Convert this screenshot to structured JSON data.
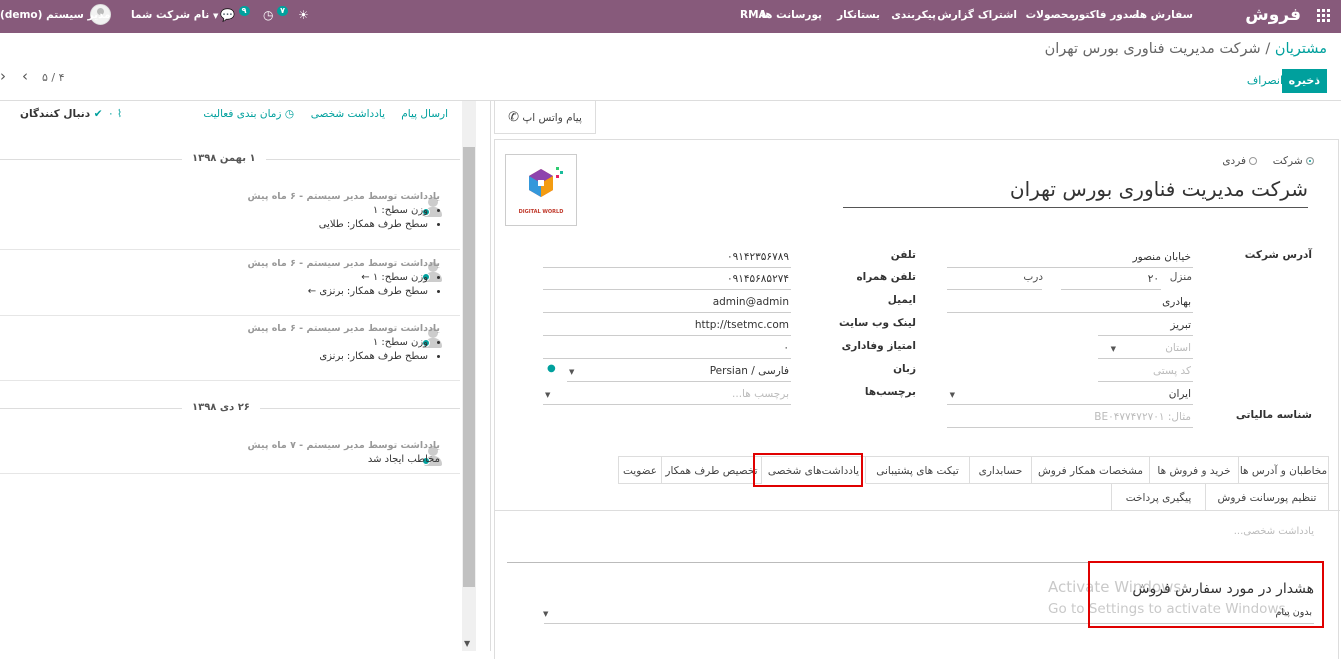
{
  "topbar": {
    "brand": "فروش",
    "menu": [
      "سفارش ها",
      "صدور فاکتور",
      "محصولات",
      "اشتراک",
      "گزارش",
      "پیکربندی",
      "بستانکار",
      "پورسانت ها",
      "RMA"
    ],
    "messages_count": "۹",
    "activities_count": "۷",
    "company": "نام شرکت شما",
    "user": "مدیر سیستم (demo)"
  },
  "breadcrumb": {
    "parent": "مشتریان",
    "separator": "/",
    "current": "شرکت مدیریت فناوری بورس تهران"
  },
  "buttons": {
    "save": "ذخیره",
    "discard": "انصراف"
  },
  "pager": {
    "value": "۵ / ۴"
  },
  "stat": {
    "whatsapp": "پیام واتس اپ"
  },
  "company_type": {
    "individual": "فردی",
    "company": "شرکت",
    "selected": "company"
  },
  "partner_name": "شرکت مدیریت فناوری بورس تهران",
  "logo": {
    "text": "DIGITAL WORLD"
  },
  "address": {
    "label": "آدرس شرکت",
    "street": "خیابان منصور",
    "unit_label": "منزل",
    "unit": "۲۰",
    "door_label": "درب",
    "street2": "بهادری",
    "city": "تبریز",
    "state_placeholder": "استان",
    "zip_placeholder": "کد پستی",
    "country": "ایران"
  },
  "vat": {
    "label": "شناسه مالیاتی",
    "placeholder": "مثال: BE۰۴۷۷۴۷۲۷۰۱"
  },
  "contact": {
    "phone_label": "تلفن",
    "phone": "۰۹۱۴۲۳۵۶۷۸۹",
    "mobile_label": "تلفن همراه",
    "mobile": "۰۹۱۴۵۶۸۵۲۷۴",
    "email_label": "ایمیل",
    "email": "admin@admin",
    "website_label": "لینک وب سایت",
    "website": "http://tsetmc.com",
    "loyalty_label": "امتیاز وفاداری",
    "loyalty": "۰",
    "lang_label": "زبان",
    "lang": "Persian / فارسی",
    "tags_label": "برچسب‌ها",
    "tags_placeholder": "برچسب ها..."
  },
  "tabs": [
    "مخاطبان و آدرس ها",
    "خرید و فروش ها",
    "مشخصات همکار فروش",
    "حسابداری",
    "تیکت های پشتیبانی",
    "یادداشت‌های شخصی",
    "تخصیص طرف همکار",
    "عضویت",
    "تنظیم پورسانت فروش",
    "پیگیری پرداخت"
  ],
  "notes": {
    "placeholder": "یادداشت شخصی...",
    "warning_title": "هشدار در مورد سفارش فروش",
    "warning_value": "بدون پیام"
  },
  "watermark": {
    "line1": "Activate Windows",
    "line2": "Go to Settings to activate Windows."
  },
  "chatter": {
    "send_message": "ارسال پیام",
    "log_note": "یادداشت شخصی",
    "schedule": "زمان بندی فعالیت",
    "attachments": "۰",
    "followers": "دنبال کنندگان",
    "date1": "۱ بهمن ۱۳۹۸",
    "date2": "۲۶ دی ۱۳۹۸",
    "messages": [
      {
        "author": "یادداشت توسط مدیر سیستم",
        "ago": "۶ ماه پیش",
        "lines": [
          "وزن سطح: ۱",
          "سطح طرف همکار: طلایی"
        ]
      },
      {
        "author": "یادداشت توسط مدیر سیستم",
        "ago": "۶ ماه پیش",
        "lines": [
          "وزن سطح: ۱ ←",
          "سطح طرف همکار: برنزی ←"
        ]
      },
      {
        "author": "یادداشت توسط مدیر سیستم",
        "ago": "۶ ماه پیش",
        "lines": [
          "وزن سطح: ۱",
          "سطح طرف همکار: برنزی"
        ]
      },
      {
        "author": "یادداشت توسط مدیر سیستم",
        "ago": "۷ ماه پیش",
        "lines": [
          "مخاطب ایجاد شد"
        ]
      }
    ]
  }
}
